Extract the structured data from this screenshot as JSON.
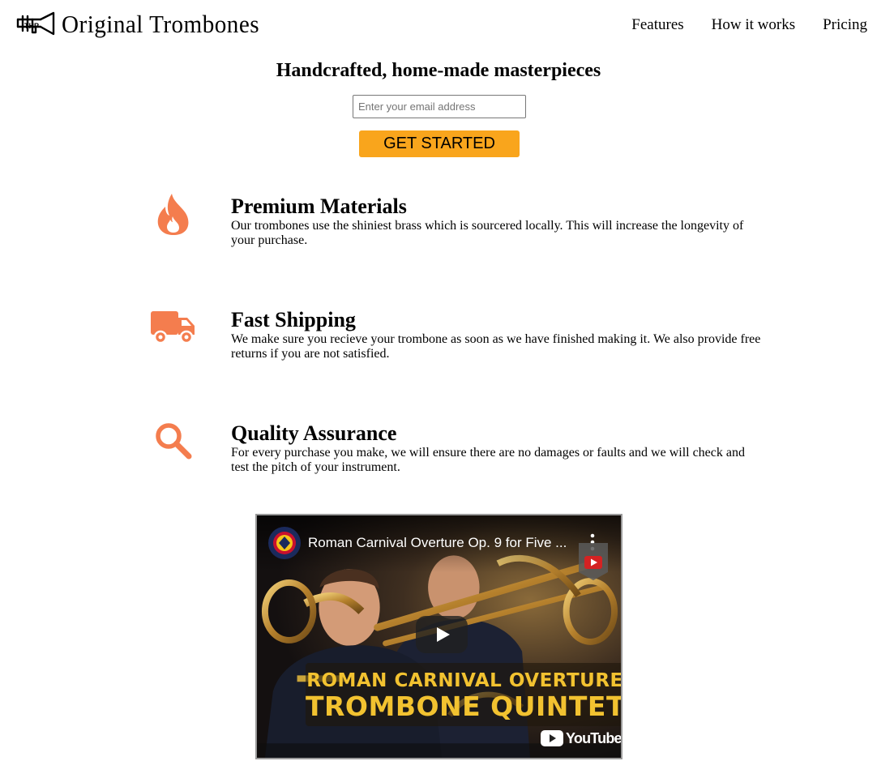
{
  "header": {
    "logo_text": "Original Trombones",
    "nav": [
      {
        "label": "Features"
      },
      {
        "label": "How it works"
      },
      {
        "label": "Pricing"
      }
    ]
  },
  "hero": {
    "title": "Handcrafted, home-made masterpieces",
    "email_placeholder": "Enter your email address",
    "email_value": "",
    "cta_label": "GET STARTED"
  },
  "features": [
    {
      "icon": "fire-icon",
      "title": "Premium Materials",
      "text": "Our trombones use the shiniest brass which is sourcered locally. This will increase the longevity of your purchase."
    },
    {
      "icon": "truck-icon",
      "title": "Fast Shipping",
      "text": "We make sure you recieve your trombone as soon as we have finished making it. We also provide free returns if you are not satisfied."
    },
    {
      "icon": "search-icon",
      "title": "Quality Assurance",
      "text": "For every purchase you make, we will ensure there are no damages or faults and we will check and test the pitch of your instrument."
    }
  ],
  "video": {
    "title": "Roman Carnival Overture Op. 9 for Five ...",
    "overlay_line1": "ROMAN CARNIVAL OVERTURE",
    "overlay_line2": "TROMBONE QUINTET",
    "brand": "YouTube"
  },
  "colors": {
    "accent": "#f9a51c",
    "icon": "#f47d4e",
    "overlay_text": "#f2c230",
    "youtube_red": "#d42222"
  }
}
